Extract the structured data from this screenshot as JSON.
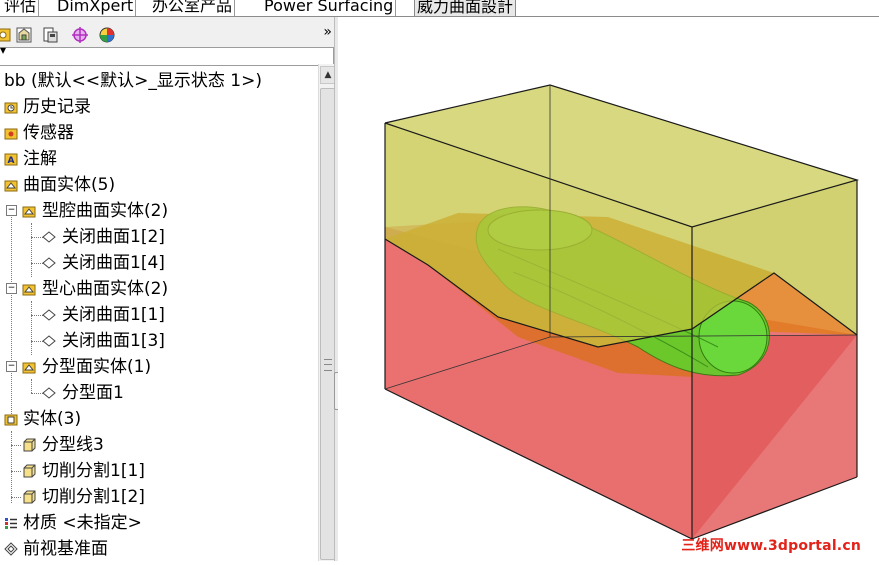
{
  "tabs": [
    {
      "label": "评估",
      "active": false
    },
    {
      "label": "DimXpert",
      "active": false
    },
    {
      "label": "办公室产品",
      "active": false
    },
    {
      "label": "Power Surfacing",
      "active": false
    },
    {
      "label": "威力曲面設計",
      "active": true
    }
  ],
  "toolbar": {
    "buttons": [
      "feature-manager-icon",
      "property-manager-icon",
      "configuration-manager-icon",
      "dimxpert-manager-icon",
      "display-manager-icon"
    ],
    "more": "»"
  },
  "filter": {
    "glyph": "▾"
  },
  "tree": {
    "root": "bb  (默认<<默认>_显示状态 1>)",
    "items": [
      {
        "label": "历史记录",
        "icon": "history-folder-icon"
      },
      {
        "label": "传感器",
        "icon": "sensors-folder-icon"
      },
      {
        "label": "注解",
        "icon": "annotations-folder-icon"
      },
      {
        "label": "曲面实体(5)",
        "icon": "surface-bodies-folder-icon"
      },
      {
        "label": "型腔曲面实体(2)",
        "icon": "surface-folder-icon"
      },
      {
        "label": "关闭曲面1[2]",
        "icon": "surface-body-icon"
      },
      {
        "label": "关闭曲面1[4]",
        "icon": "surface-body-icon"
      },
      {
        "label": "型心曲面实体(2)",
        "icon": "surface-folder-icon"
      },
      {
        "label": "关闭曲面1[1]",
        "icon": "surface-body-icon"
      },
      {
        "label": "关闭曲面1[3]",
        "icon": "surface-body-icon"
      },
      {
        "label": "分型面实体(1)",
        "icon": "surface-folder-icon"
      },
      {
        "label": "分型面1",
        "icon": "surface-body-icon"
      },
      {
        "label": "实体(3)",
        "icon": "solid-bodies-folder-icon"
      },
      {
        "label": "分型线3",
        "icon": "solid-body-icon"
      },
      {
        "label": "切削分割1[1]",
        "icon": "solid-body-icon"
      },
      {
        "label": "切削分割1[2]",
        "icon": "solid-body-icon"
      },
      {
        "label": "材质 <未指定>",
        "icon": "material-icon"
      },
      {
        "label": "前视基准面",
        "icon": "plane-icon"
      }
    ]
  },
  "watermark": "三维网www.3dportal.cn",
  "colors": {
    "cavity": "#c8c84a",
    "core": "#e04a4a",
    "part": "#5fd12a",
    "parting": "#e27d1c",
    "watermark": "#e2231a"
  }
}
